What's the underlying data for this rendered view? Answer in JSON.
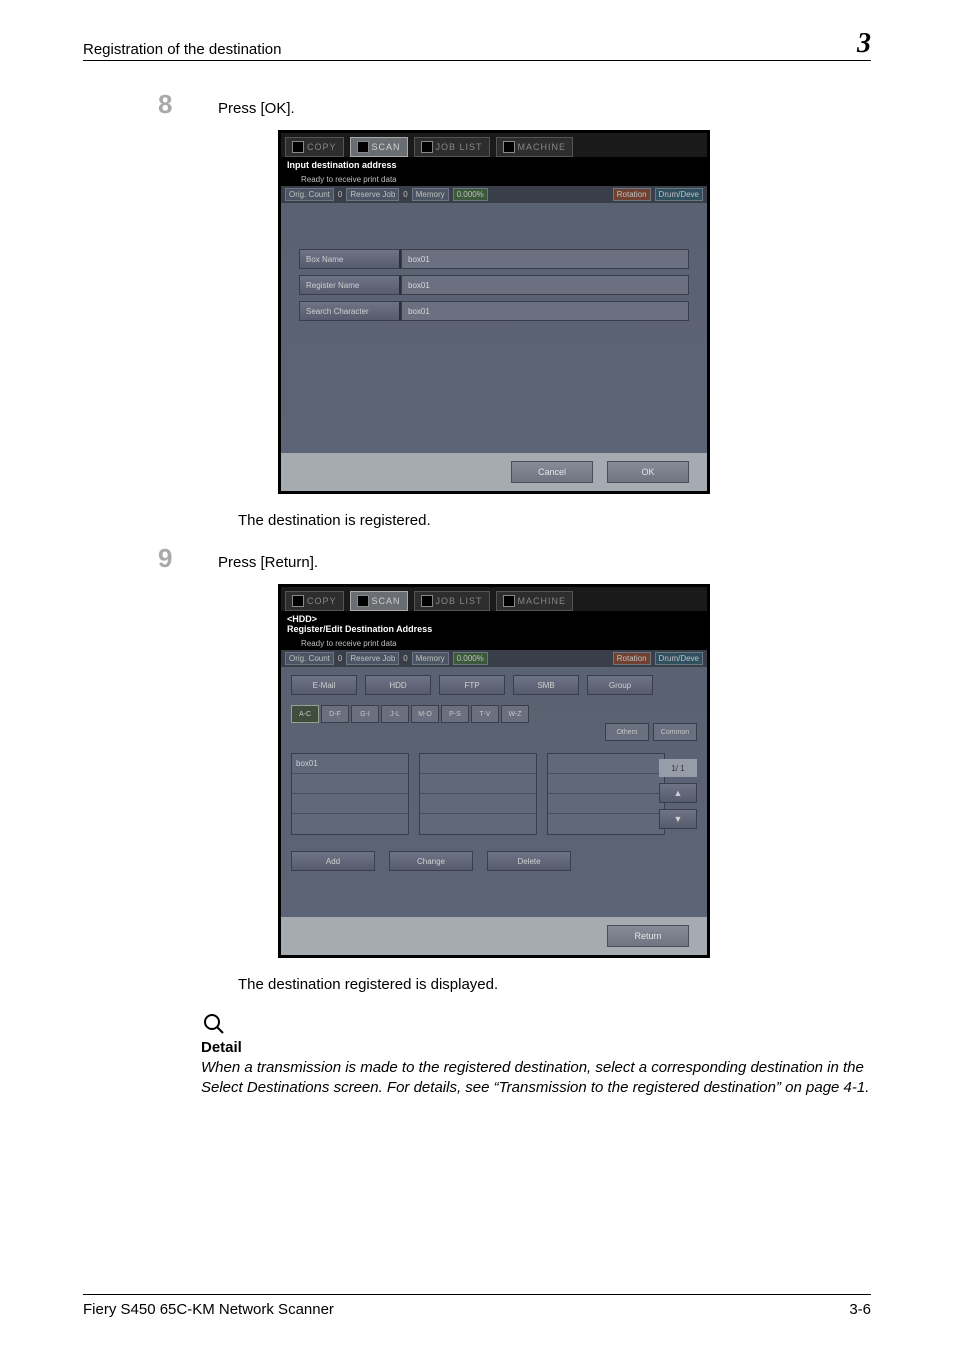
{
  "header": {
    "title": "Registration of the destination",
    "chapter": "3"
  },
  "step8": {
    "number": "8",
    "text": "Press [OK].",
    "after": "The destination is registered."
  },
  "step9": {
    "number": "9",
    "text": "Press [Return].",
    "after": "The destination registered is displayed."
  },
  "ss1": {
    "tabs": {
      "copy": "COPY",
      "scan": "SCAN",
      "joblist": "JOB LIST",
      "machine": "MACHINE"
    },
    "title": "Input destination address",
    "subtitle": "Ready to receive print data",
    "status": {
      "orig": "Orig. Count",
      "orig_v": "0",
      "res": "Reserve Job",
      "res_v": "0",
      "mem": "Memory",
      "mem_v": "0.000%",
      "rot": "Rotation",
      "drum": "Drum/Deve"
    },
    "fields": {
      "box_name_l": "Box Name",
      "box_name_v": "box01",
      "reg_name_l": "Register Name",
      "reg_name_v": "box01",
      "search_l": "Search Character",
      "search_v": "box01"
    },
    "buttons": {
      "cancel": "Cancel",
      "ok": "OK"
    }
  },
  "ss2": {
    "tabs": {
      "copy": "COPY",
      "scan": "SCAN",
      "joblist": "JOB LIST",
      "machine": "MACHINE"
    },
    "title": "<HDD>\nRegister/Edit Destination Address",
    "subtitle": "Ready to receive print data",
    "status": {
      "orig": "Orig. Count",
      "orig_v": "0",
      "res": "Reserve Job",
      "res_v": "0",
      "mem": "Memory",
      "mem_v": "0.000%",
      "rot": "Rotation",
      "drum": "Drum/Deve"
    },
    "top_btns": {
      "email": "E-Mail",
      "hdd": "HDD",
      "ftp": "FTP",
      "smb": "SMB",
      "group": "Group"
    },
    "alpha": [
      "A-C",
      "D-F",
      "G-I",
      "J-L",
      "M-O",
      "P-S",
      "T-V",
      "W-Z"
    ],
    "right": {
      "others": "Others",
      "common": "Common"
    },
    "list_item": "box01",
    "page_ind": "1/  1",
    "up": "▲",
    "down": "▼",
    "bottom_btns": {
      "add": "Add",
      "change": "Change",
      "delete": "Delete"
    },
    "return": "Return"
  },
  "detail": {
    "title": "Detail",
    "body": "When a transmission is made to the registered destination, select a corresponding destination in the Select Destinations screen. For details, see “Transmission to the registered destination” on page 4-1."
  },
  "footer": {
    "left": "Fiery S450 65C-KM Network Scanner",
    "right": "3-6"
  }
}
